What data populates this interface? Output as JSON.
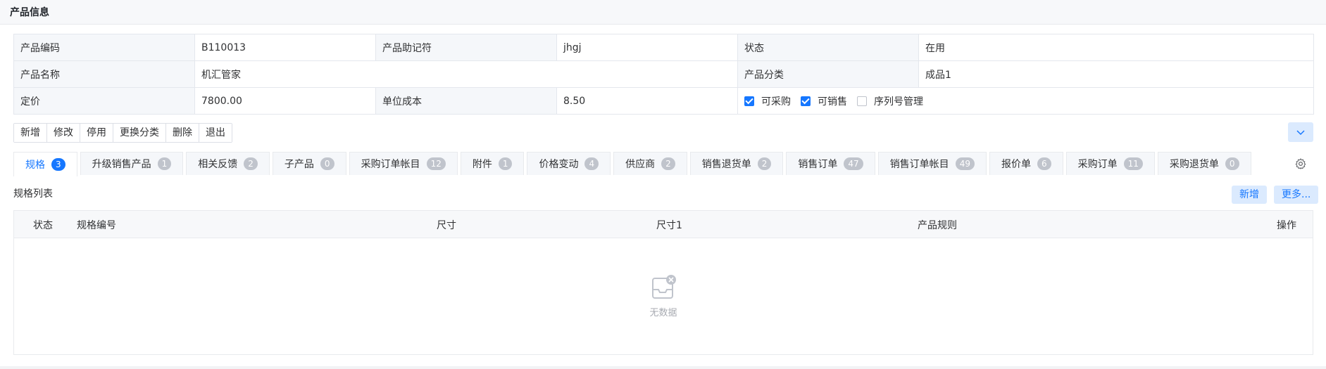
{
  "header": {
    "title": "产品信息"
  },
  "info": {
    "row1": {
      "code_label": "产品编码",
      "code_value": "B110013",
      "mnemonic_label": "产品助记符",
      "mnemonic_value": "jhgj",
      "status_label": "状态",
      "status_value": "在用"
    },
    "row2": {
      "name_label": "产品名称",
      "name_value": "机汇管家",
      "category_label": "产品分类",
      "category_value": "成品1"
    },
    "row3": {
      "price_label": "定价",
      "price_value": "7800.00",
      "cost_label": "单位成本",
      "cost_value": "8.50",
      "checkboxes": [
        {
          "label": "可采购",
          "checked": true
        },
        {
          "label": "可销售",
          "checked": true
        },
        {
          "label": "序列号管理",
          "checked": false
        }
      ]
    }
  },
  "toolbar": {
    "buttons": [
      "新增",
      "修改",
      "停用",
      "更换分类",
      "删除",
      "退出"
    ]
  },
  "tabs": [
    {
      "label": "规格",
      "count": "3",
      "active": true
    },
    {
      "label": "升级销售产品",
      "count": "1"
    },
    {
      "label": "相关反馈",
      "count": "2"
    },
    {
      "label": "子产品",
      "count": "0"
    },
    {
      "label": "采购订单帐目",
      "count": "12"
    },
    {
      "label": "附件",
      "count": "1"
    },
    {
      "label": "价格变动",
      "count": "4"
    },
    {
      "label": "供应商",
      "count": "2"
    },
    {
      "label": "销售退货单",
      "count": "2"
    },
    {
      "label": "销售订单",
      "count": "47"
    },
    {
      "label": "销售订单帐目",
      "count": "49"
    },
    {
      "label": "报价单",
      "count": "6"
    },
    {
      "label": "采购订单",
      "count": "11"
    },
    {
      "label": "采购退货单",
      "count": "0"
    }
  ],
  "spec_section": {
    "title": "规格列表",
    "add_label": "新增",
    "more_label": "更多...",
    "columns": [
      "状态",
      "规格编号",
      "尺寸",
      "尺寸1",
      "产品规则",
      "操作"
    ],
    "empty_text": "无数据"
  },
  "icons": {
    "collapse": "chevron-down-icon",
    "settings": "gear-icon",
    "empty": "empty-inbox-icon"
  },
  "colors": {
    "accent": "#1677ff",
    "accent_light": "#dbeafe",
    "badge_gray": "#c0c4cc"
  }
}
